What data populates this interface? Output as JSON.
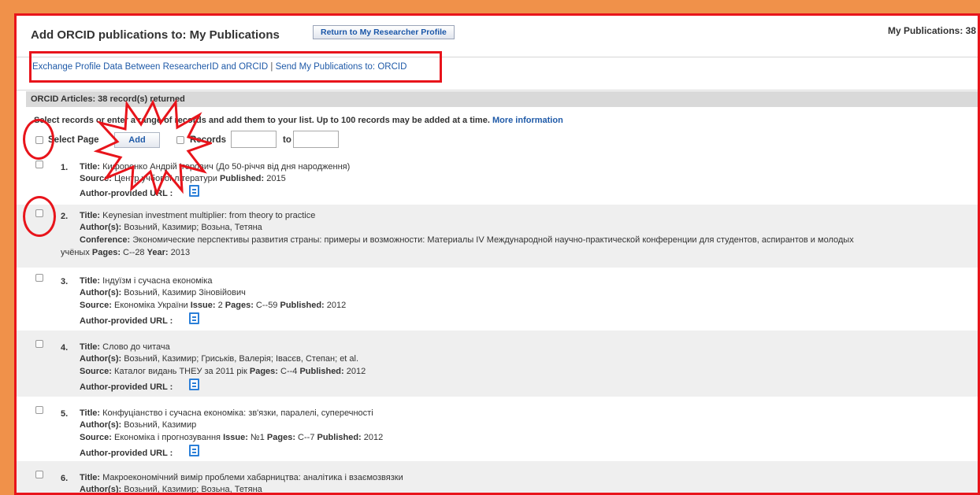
{
  "header": {
    "title": "Add ORCID publications to: My Publications",
    "return_button": "Return to My Researcher Profile",
    "my_publications": "My Publications: 38"
  },
  "links": {
    "exchange": "Exchange Profile Data Between ResearcherID and ORCID",
    "separator": "|",
    "send": "Send My Publications to: ORCID"
  },
  "results": {
    "summary": "ORCID Articles: 38 record(s) returned"
  },
  "instructions": {
    "text": "Select records or enter a range of records and add them to your list. Up to 100 records may be added at a time.",
    "more_link": "More information"
  },
  "toolbar": {
    "select_page": "Select Page",
    "add": "Add",
    "records": "Records",
    "to": "to",
    "range_from": "",
    "range_to": ""
  },
  "labels": {
    "title": "Title:",
    "authors": "Author(s):",
    "source": "Source:",
    "conference": "Conference:",
    "pages": "Pages:",
    "year": "Year:",
    "published": "Published:",
    "issue": "Issue:",
    "url": "Author-provided URL :"
  },
  "records": [
    {
      "num": "1.",
      "title": "Кифоренко Андрій Ігорович (До 50-річчя від дня народження)",
      "source": "Центр учбової літератури",
      "published": "2015"
    },
    {
      "num": "2.",
      "title": "Keynesian investment multiplier: from theory to practice",
      "authors": "Возьний, Казимир; Возьна, Тетяна",
      "conference": "Экономические перспективы развития страны: примеры и возможности: Материалы IV Международной научно-практической конференции для студентов, аспирантов и молодых",
      "conference_cont": "учёных",
      "pages": "C--28",
      "year": "2013"
    },
    {
      "num": "3.",
      "title": "Індуїзм і сучасна економіка",
      "authors": "Возьний, Казимир Зіновійович",
      "source": "Економіка України",
      "issue": "2",
      "pages": "C--59",
      "published": "2012"
    },
    {
      "num": "4.",
      "title": "Слово до читача",
      "authors": "Возьний, Казимир; Гриськів, Валерія; Івасєв, Степан; et al.",
      "source": "Каталог видань ТНЕУ за 2011 рік",
      "pages": "C--4",
      "published": "2012"
    },
    {
      "num": "5.",
      "title": "Конфуціанство і сучасна економіка: зв'язки, паралелі, суперечності",
      "authors": "Возьний, Казимир",
      "source": "Економіка і прогнозування",
      "issue": "№1",
      "pages": "C--7",
      "published": "2012"
    },
    {
      "num": "6.",
      "title": "Макроекономічний вимір проблеми хабарництва: аналітика і взаємозвязки",
      "authors": "Возьний, Казимир; Возьна, Тетяна"
    }
  ],
  "colors": {
    "background": "#f0914a",
    "highlight": "#e8141b",
    "link": "#1f5aa8",
    "shaded_row": "#efefef",
    "results_bar": "#d9d9d9"
  }
}
